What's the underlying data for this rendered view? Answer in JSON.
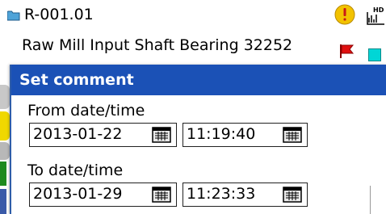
{
  "item": {
    "id": "R-001.01",
    "description": "Raw Mill Input Shaft Bearing 32252",
    "hd_label": "HD"
  },
  "dialog": {
    "title": "Set comment",
    "from_label": "From date/time",
    "from_date": "2013-01-22",
    "from_time": "11:19:40",
    "to_label": "To date/time",
    "to_date": "2013-01-29",
    "to_time": "11:23:33"
  },
  "icons": {
    "folder": "folder-icon",
    "alert": "alert-icon",
    "hd": "hd-icon",
    "flag": "flag-icon",
    "calendar": "calendar-icon"
  },
  "colors": {
    "title_bar": "#1b51b6",
    "alert": "#f2c200",
    "flag": "#e01010",
    "marker": "#00d6d6"
  }
}
